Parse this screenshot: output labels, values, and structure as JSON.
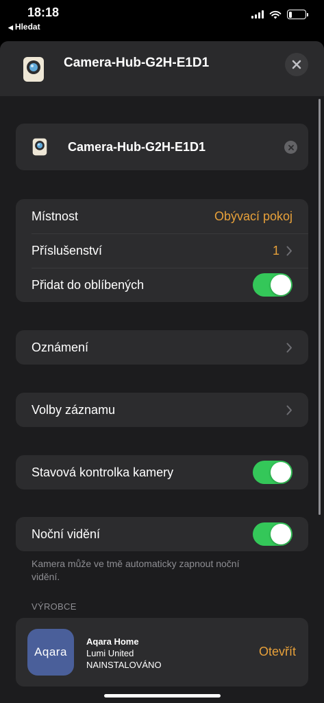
{
  "status_bar": {
    "time": "18:18",
    "back_label": "Hledat",
    "back_glyph": "◀",
    "battery_level": 0.2
  },
  "header": {
    "title": "Camera-Hub-G2H-E1D1",
    "close_glyph": "✕"
  },
  "name_field": {
    "value": "Camera-Hub-G2H-E1D1"
  },
  "settings_group_1": {
    "room": {
      "label": "Místnost",
      "value": "Obývací pokoj"
    },
    "accessories": {
      "label": "Příslušenství",
      "value": "1",
      "chevron": "›"
    },
    "favorites": {
      "label": "Přidat do oblíbených",
      "on": true
    }
  },
  "notifications": {
    "label": "Oznámení",
    "chevron": "›"
  },
  "recording_options": {
    "label": "Volby záznamu",
    "chevron": "›"
  },
  "status_light": {
    "label": "Stavová kontrolka kamery",
    "on": true
  },
  "night_vision": {
    "label": "Noční vidění",
    "on": true,
    "footnote": "Kamera může ve tmě automaticky zapnout noční vidění."
  },
  "manufacturer": {
    "section_label": "VÝROBCE",
    "logo_text": "Aqara",
    "app_name": "Aqara Home",
    "developer": "Lumi United",
    "state": "NAINSTALOVÁNO",
    "open_label": "Otevřít"
  },
  "colors": {
    "accent": "#e8a13a",
    "toggle_on": "#34c759",
    "sheet_bg": "#1c1c1e",
    "card_bg": "#2c2c2e"
  }
}
